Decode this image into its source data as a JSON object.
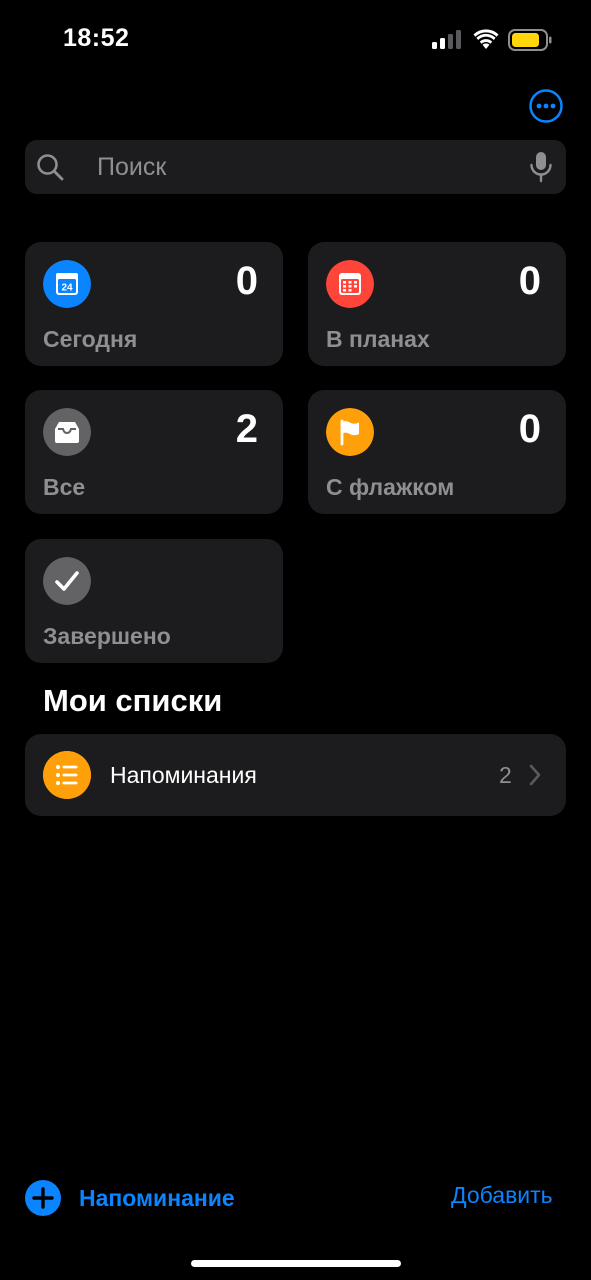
{
  "status_bar": {
    "time": "18:52",
    "icons": [
      "cellular-signal-icon",
      "wifi-icon",
      "battery-icon"
    ],
    "battery_color": "#ffd60a"
  },
  "header": {
    "more_icon": "ellipsis-circle-icon"
  },
  "search": {
    "placeholder": "Поиск",
    "search_icon": "magnifying-glass-icon",
    "mic_icon": "microphone-icon"
  },
  "smart_lists": [
    {
      "label": "Сегодня",
      "count": "0",
      "icon": "calendar-today-icon",
      "icon_text": "24",
      "color": "#0a84ff"
    },
    {
      "label": "В планах",
      "count": "0",
      "icon": "calendar-icon",
      "color": "#ff453a"
    },
    {
      "label": "Все",
      "count": "2",
      "icon": "tray-icon",
      "color": "#636366"
    },
    {
      "label": "С флажком",
      "count": "0",
      "icon": "flag-icon",
      "color": "#ff9f0a"
    },
    {
      "label": "Завершено",
      "icon": "checkmark-icon",
      "color": "#636366"
    }
  ],
  "my_lists": {
    "title": "Мои списки",
    "items": [
      {
        "name": "Напоминания",
        "count": "2",
        "icon": "list-bullet-icon",
        "color": "#ff9f0a"
      }
    ]
  },
  "toolbar": {
    "new_reminder_label": "Напоминание",
    "add_list_label": "Добавить",
    "accent": "#0a84ff"
  }
}
